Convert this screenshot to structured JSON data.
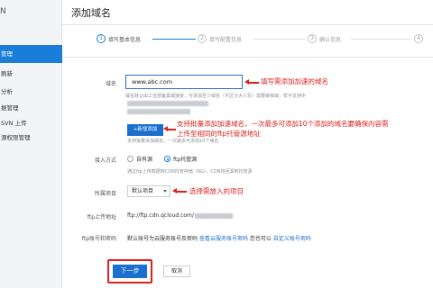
{
  "sidebar": {
    "brand": "N",
    "items": [
      {
        "label": "管理",
        "active": true
      },
      {
        "label": "刷新",
        "active": false
      },
      {
        "label": "分析",
        "active": false
      },
      {
        "label": "据管理",
        "active": false
      },
      {
        "label": "SVN 上传",
        "active": false
      },
      {
        "label": "源权限管理",
        "active": false
      }
    ]
  },
  "header": {
    "title": "添加域名"
  },
  "steps": [
    {
      "num": "1",
      "label": "填写基本信息"
    },
    {
      "num": "2",
      "label": "填写配置信息"
    },
    {
      "num": "3",
      "label": "确认信息"
    },
    {
      "num": "4",
      "label": ""
    }
  ],
  "form": {
    "domain": {
      "label": "域名",
      "value": "www.abc.com",
      "hint": "域名默认由工信部备案或接受，可添加至少域名（不区分大小写）需要审核域，暂不支持中文域名"
    },
    "add_domain_button": "+新增添加",
    "add_hint": "支持批量添加域名，一次最多可添加10个域名",
    "access_mode": {
      "label": "接入方式",
      "options": [
        {
          "label": "自有源",
          "checked": false
        },
        {
          "label": "ftp托管源",
          "checked": true
        }
      ],
      "hint": "通过ftp上传数据到CDN托管存储（6G），CDN将回源到托管源"
    },
    "project": {
      "label": "所属项目",
      "value": "默认项目"
    },
    "ftp_address": {
      "label": "ftp上传地址",
      "value": "ftp://ftp.cdn.qcloud.com/"
    },
    "ftp_account": {
      "label": "ftp账号和密码",
      "text_prefix": "默认账号为云服务账号及密码",
      "link1": "查看云服务账号密码",
      "text_mid": "您也可以",
      "link2": "自定义账号密码"
    },
    "next_button": "下一步",
    "cancel_button": "取消"
  },
  "annotations": {
    "domain": "填写需添加加速的域名",
    "batch": "支持批量添加加速域名，一次最多可添加10个添加的域名要确保内容需上传至相同的ftp托管源地址",
    "project": "选择需放入的项目"
  },
  "colors": {
    "accent": "#1a6fcf",
    "annotation": "#e0201c"
  }
}
